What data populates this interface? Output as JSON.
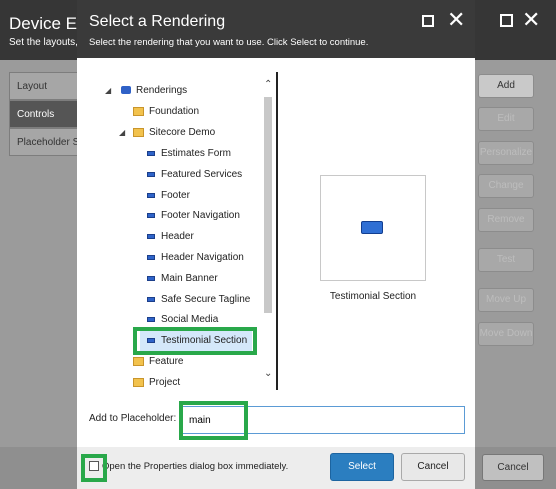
{
  "background": {
    "title": "Device Edi",
    "subtitle": "Set the layouts,",
    "tabs": [
      "Layout",
      "Controls",
      "Placeholder S"
    ],
    "buttons": [
      "Add",
      "Edit",
      "Personalize",
      "Change",
      "Remove",
      "Test",
      "Move Up",
      "Move Down"
    ],
    "cancel": "Cancel"
  },
  "dialog": {
    "title": "Select a Rendering",
    "subtitle": "Select the rendering that you want to use. Click Select to continue.",
    "tree": [
      {
        "label": "Renderings",
        "icon": "renderings-icon"
      },
      {
        "label": "Foundation",
        "icon": "folder-icon"
      },
      {
        "label": "Sitecore Demo",
        "icon": "folder-icon"
      },
      {
        "label": "Estimates Form",
        "icon": "rendering-icon"
      },
      {
        "label": "Featured Services",
        "icon": "rendering-icon"
      },
      {
        "label": "Footer",
        "icon": "rendering-icon"
      },
      {
        "label": "Footer Navigation",
        "icon": "rendering-icon"
      },
      {
        "label": "Header",
        "icon": "rendering-icon"
      },
      {
        "label": "Header Navigation",
        "icon": "rendering-icon"
      },
      {
        "label": "Main Banner",
        "icon": "rendering-icon"
      },
      {
        "label": "Safe Secure Tagline",
        "icon": "rendering-icon"
      },
      {
        "label": "Social Media",
        "icon": "rendering-icon"
      },
      {
        "label": "Testimonial Section",
        "icon": "rendering-icon"
      },
      {
        "label": "Feature",
        "icon": "folder-icon"
      },
      {
        "label": "Project",
        "icon": "folder-icon"
      }
    ],
    "preview_label": "Testimonial Section",
    "placeholder_label": "Add to Placeholder:",
    "placeholder_value": "main",
    "checkbox_label": "Open the Properties dialog box immediately.",
    "select_label": "Select",
    "cancel_label": "Cancel"
  },
  "colors": {
    "highlight": "#29a84a",
    "primary": "#2b7ec0"
  }
}
